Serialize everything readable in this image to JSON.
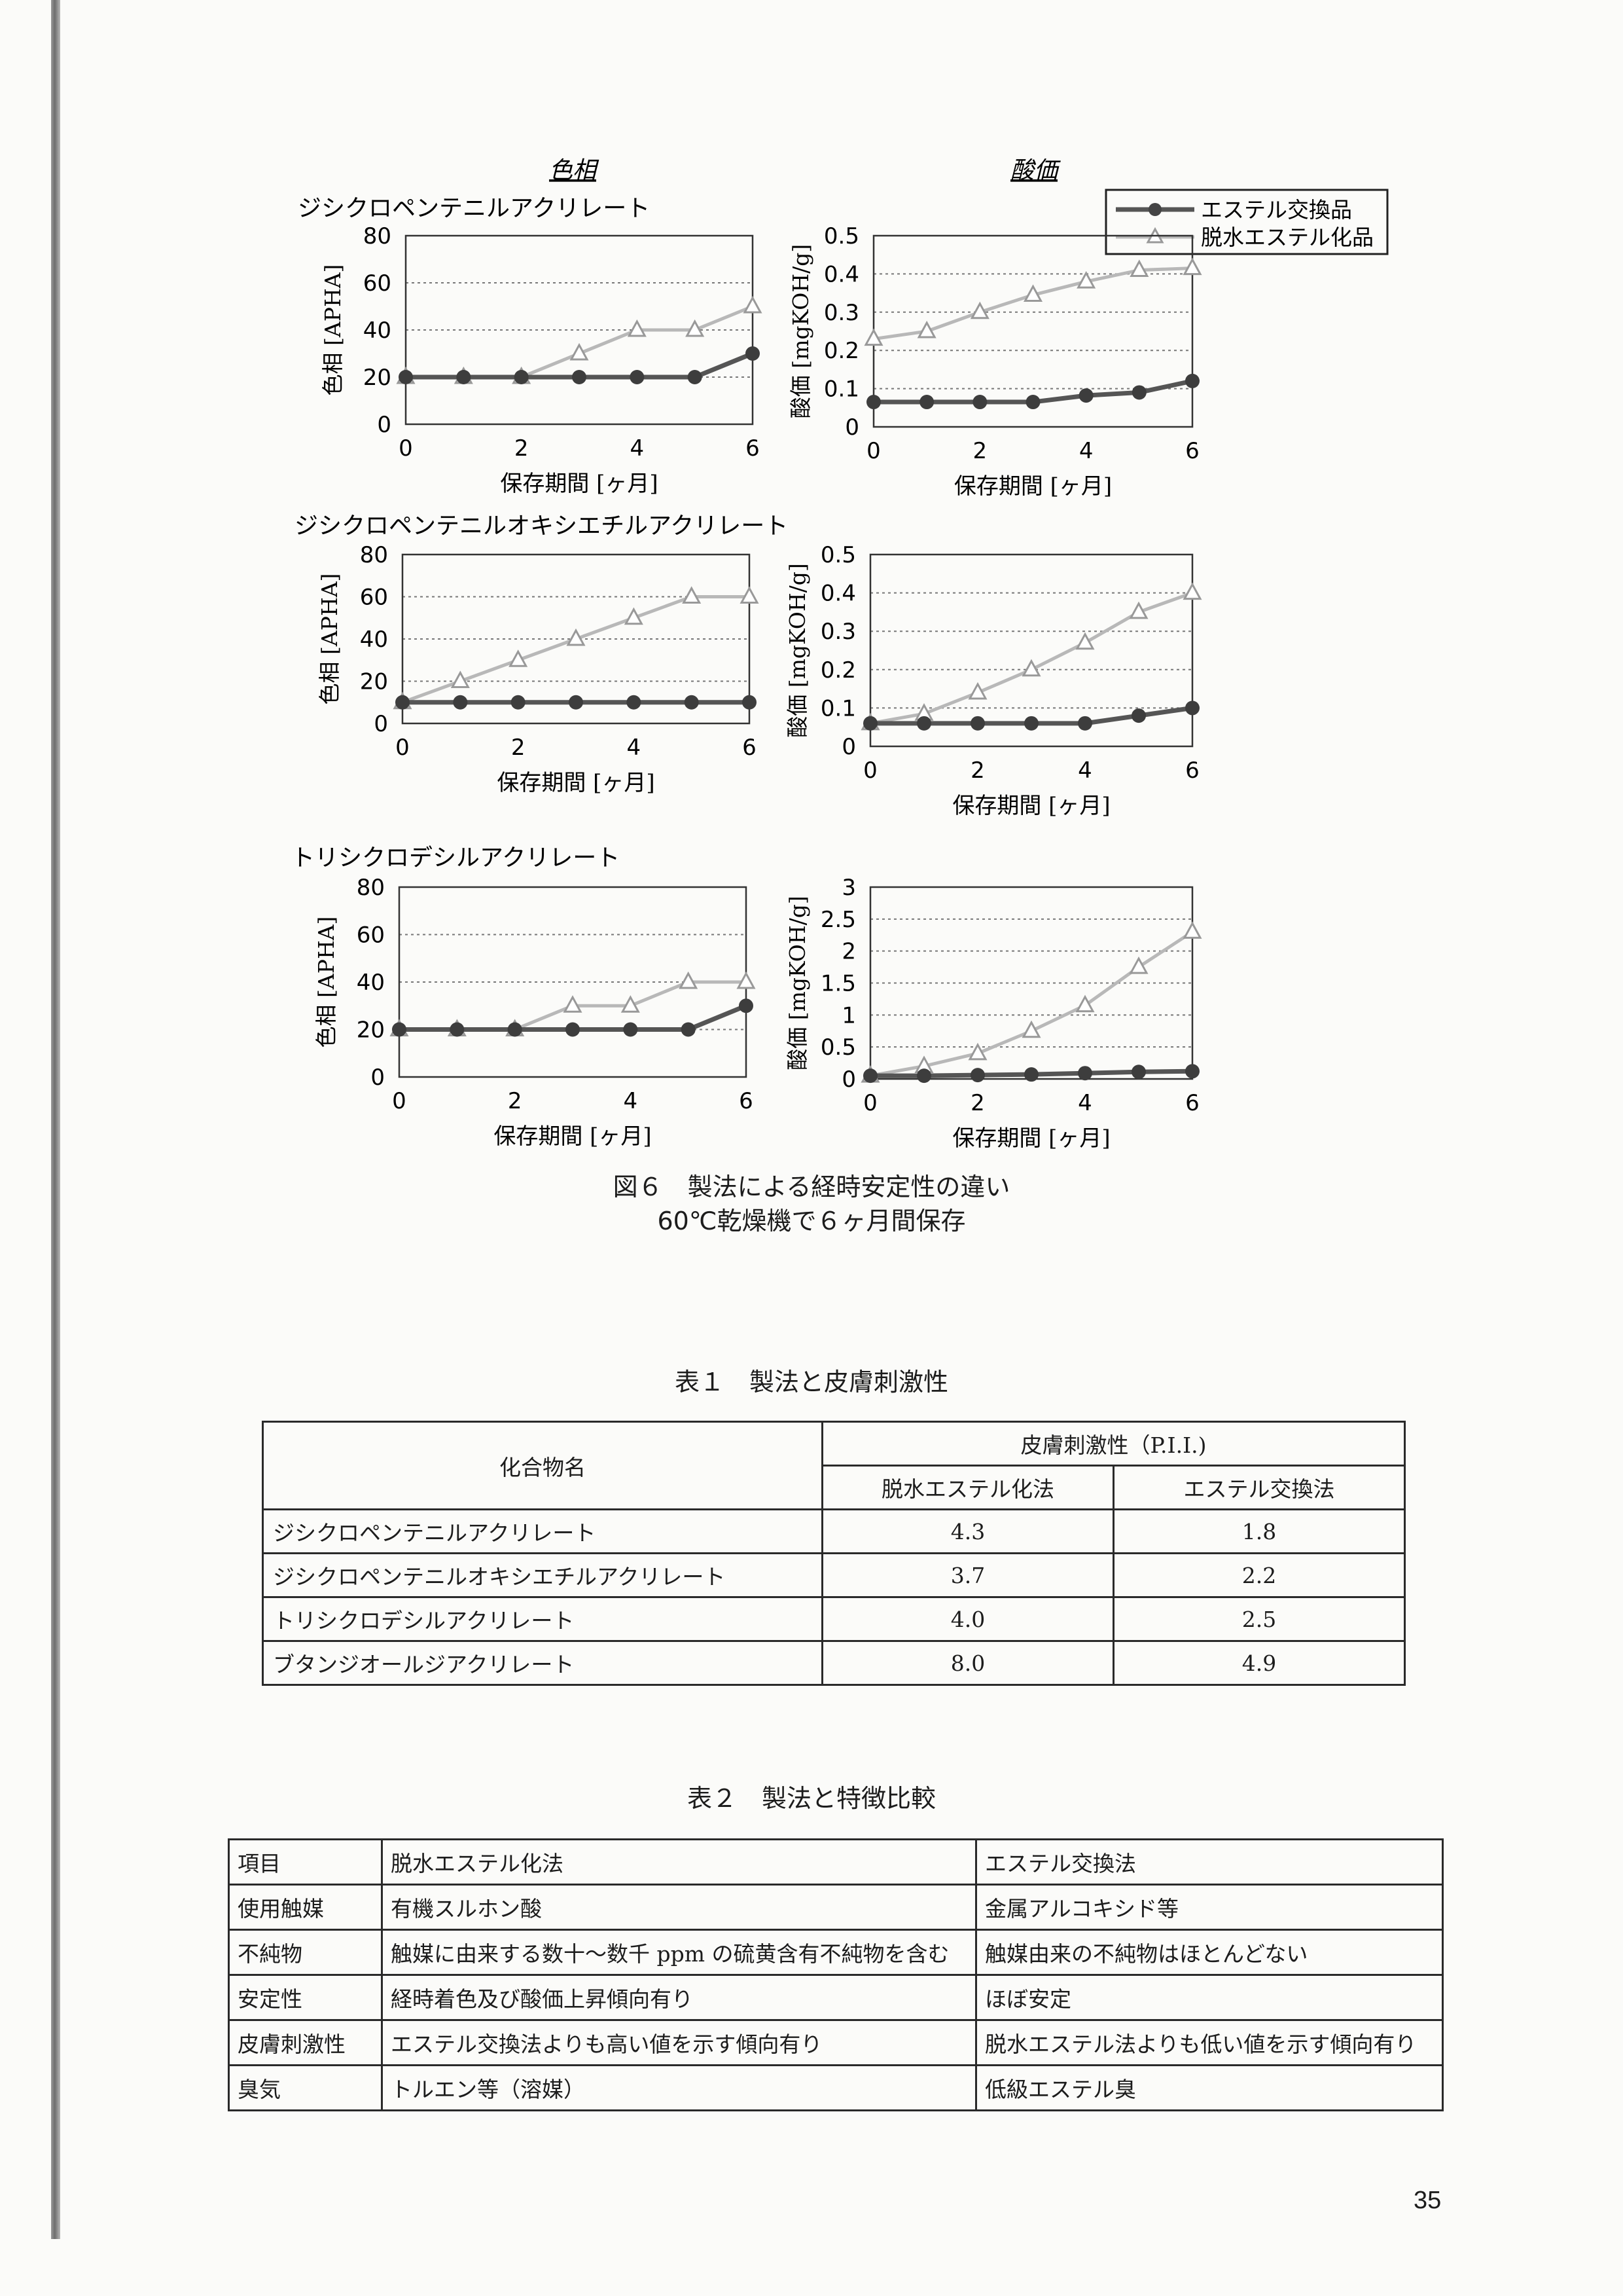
{
  "column_headers": {
    "color": "色相",
    "acid": "酸価"
  },
  "legend": {
    "items": [
      "エステル交換品",
      "脱水エステル化品"
    ]
  },
  "chart_data": [
    {
      "type": "line",
      "row_title": "ジシクロペンテニルアクリレート",
      "xlabel": "保存期間 [ヶ月]",
      "ylabel": "色相 [APHA]",
      "xlim": [
        0,
        6
      ],
      "ylim": [
        0,
        80
      ],
      "yticks": [
        "0",
        "20",
        "40",
        "60",
        "80"
      ],
      "xticks": [
        "0",
        "2",
        "4",
        "6"
      ],
      "x": [
        0,
        1,
        2,
        3,
        4,
        5,
        6
      ],
      "series": [
        {
          "name": "エステル交換品",
          "values": [
            20,
            20,
            20,
            20,
            20,
            20,
            30
          ]
        },
        {
          "name": "脱水エステル化品",
          "values": [
            20,
            20,
            20,
            30,
            40,
            40,
            50
          ]
        }
      ]
    },
    {
      "type": "line",
      "xlabel": "保存期間 [ヶ月]",
      "ylabel": "酸価 [mgKOH/g]",
      "xlim": [
        0,
        6
      ],
      "ylim": [
        0,
        0.5
      ],
      "yticks": [
        "0",
        "0.1",
        "0.2",
        "0.3",
        "0.4",
        "0.5"
      ],
      "xticks": [
        "0",
        "2",
        "4",
        "6"
      ],
      "x": [
        0,
        1,
        2,
        3,
        4,
        5,
        6
      ],
      "series": [
        {
          "name": "エステル交換品",
          "values": [
            0.065,
            0.065,
            0.065,
            0.065,
            0.082,
            0.09,
            0.12
          ]
        },
        {
          "name": "脱水エステル化品",
          "values": [
            0.23,
            0.25,
            0.3,
            0.345,
            0.38,
            0.41,
            0.415
          ]
        }
      ]
    },
    {
      "type": "line",
      "row_title": "ジシクロペンテニルオキシエチルアクリレート",
      "xlabel": "保存期間 [ヶ月]",
      "ylabel": "色相 [APHA]",
      "xlim": [
        0,
        6
      ],
      "ylim": [
        0,
        80
      ],
      "yticks": [
        "0",
        "20",
        "40",
        "60",
        "80"
      ],
      "xticks": [
        "0",
        "2",
        "4",
        "6"
      ],
      "x": [
        0,
        1,
        2,
        3,
        4,
        5,
        6
      ],
      "series": [
        {
          "name": "エステル交換品",
          "values": [
            10,
            10,
            10,
            10,
            10,
            10,
            10
          ]
        },
        {
          "name": "脱水エステル化品",
          "values": [
            10,
            20,
            30,
            40,
            50,
            60,
            60
          ]
        }
      ]
    },
    {
      "type": "line",
      "xlabel": "保存期間 [ヶ月]",
      "ylabel": "酸価 [mgKOH/g]",
      "xlim": [
        0,
        6
      ],
      "ylim": [
        0,
        0.5
      ],
      "yticks": [
        "0",
        "0.1",
        "0.2",
        "0.3",
        "0.4",
        "0.5"
      ],
      "xticks": [
        "0",
        "2",
        "4",
        "6"
      ],
      "x": [
        0,
        1,
        2,
        3,
        4,
        5,
        6
      ],
      "series": [
        {
          "name": "エステル交換品",
          "values": [
            0.06,
            0.06,
            0.06,
            0.06,
            0.06,
            0.08,
            0.1
          ]
        },
        {
          "name": "脱水エステル化品",
          "values": [
            0.06,
            0.085,
            0.14,
            0.2,
            0.27,
            0.35,
            0.4
          ]
        }
      ]
    },
    {
      "type": "line",
      "row_title": "トリシクロデシルアクリレート",
      "xlabel": "保存期間 [ヶ月]",
      "ylabel": "色相 [APHA]",
      "xlim": [
        0,
        6
      ],
      "ylim": [
        0,
        80
      ],
      "yticks": [
        "0",
        "20",
        "40",
        "60",
        "80"
      ],
      "xticks": [
        "0",
        "2",
        "4",
        "6"
      ],
      "x": [
        0,
        1,
        2,
        3,
        4,
        5,
        6
      ],
      "series": [
        {
          "name": "エステル交換品",
          "values": [
            20,
            20,
            20,
            20,
            20,
            20,
            30
          ]
        },
        {
          "name": "脱水エステル化品",
          "values": [
            20,
            20,
            20,
            30,
            30,
            40,
            40
          ]
        }
      ]
    },
    {
      "type": "line",
      "xlabel": "保存期間 [ヶ月]",
      "ylabel": "酸価 [mgKOH/g]",
      "xlim": [
        0,
        6
      ],
      "ylim": [
        0,
        3
      ],
      "yticks": [
        "0",
        "0.5",
        "1",
        "1.5",
        "2",
        "2.5",
        "3"
      ],
      "xticks": [
        "0",
        "2",
        "4",
        "6"
      ],
      "x": [
        0,
        1,
        2,
        3,
        4,
        5,
        6
      ],
      "series": [
        {
          "name": "エステル交換品",
          "values": [
            0.05,
            0.05,
            0.06,
            0.07,
            0.09,
            0.11,
            0.12
          ]
        },
        {
          "name": "脱水エステル化品",
          "values": [
            0.05,
            0.2,
            0.4,
            0.75,
            1.15,
            1.75,
            2.3
          ]
        }
      ]
    }
  ],
  "figure_caption": {
    "line1": "図６　製法による経時安定性の違い",
    "line2": "60℃乾燥機で６ヶ月間保存"
  },
  "table1": {
    "caption": "表１　製法と皮膚刺激性",
    "header_name": "化合物名",
    "header_group": "皮膚刺激性（P.I.I.)",
    "header_cols": [
      "脱水エステル化法",
      "エステル交換法"
    ],
    "rows": [
      {
        "name": "ジシクロペンテニルアクリレート",
        "a": "4.3",
        "b": "1.8"
      },
      {
        "name": "ジシクロペンテニルオキシエチルアクリレート",
        "a": "3.7",
        "b": "2.2"
      },
      {
        "name": "トリシクロデシルアクリレート",
        "a": "4.0",
        "b": "2.5"
      },
      {
        "name": "ブタンジオールジアクリレート",
        "a": "8.0",
        "b": "4.9"
      }
    ]
  },
  "table2": {
    "caption": "表２　製法と特徴比較",
    "rows": [
      [
        "項目",
        "脱水エステル化法",
        "エステル交換法"
      ],
      [
        "使用触媒",
        "有機スルホン酸",
        "金属アルコキシド等"
      ],
      [
        "不純物",
        "触媒に由来する数十～数千 ppm の硫黄含有不純物を含む",
        "触媒由来の不純物はほとんどない"
      ],
      [
        "安定性",
        "経時着色及び酸価上昇傾向有り",
        "ほぼ安定"
      ],
      [
        "皮膚刺激性",
        "エステル交換法よりも高い値を示す傾向有り",
        "脱水エステル法よりも低い値を示す傾向有り"
      ],
      [
        "臭気",
        "トルエン等（溶媒）",
        "低級エステル臭"
      ]
    ]
  },
  "page_number": "35"
}
